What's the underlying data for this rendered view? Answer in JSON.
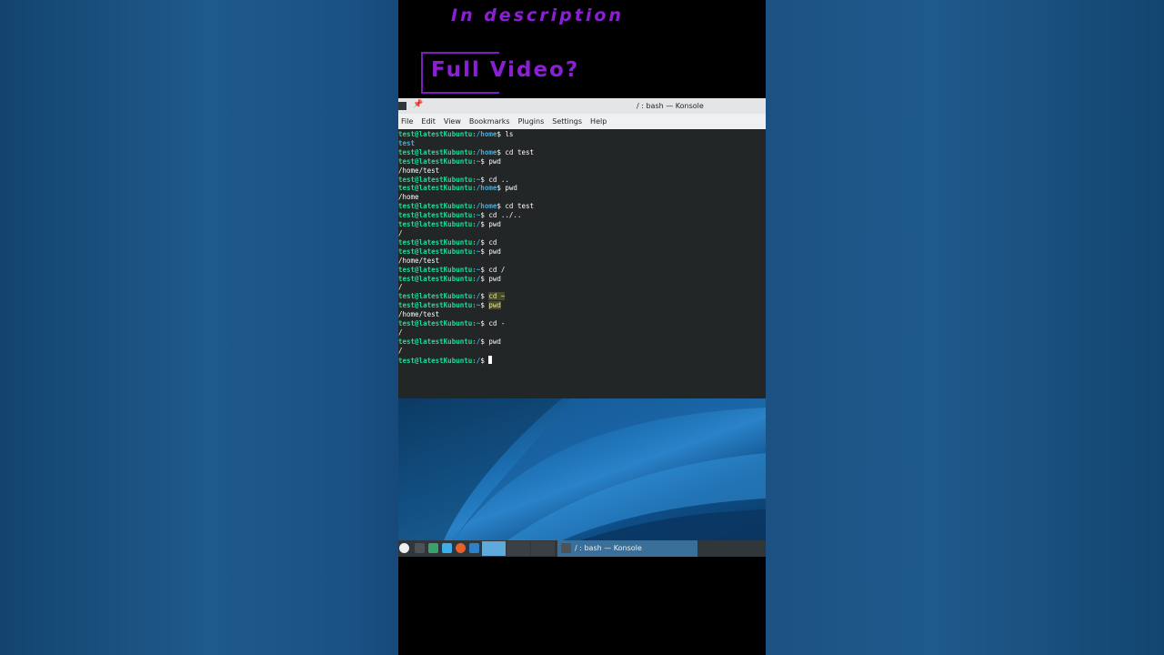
{
  "promo": {
    "top_text": "In description",
    "main_text": "Full Video?"
  },
  "window": {
    "title": "/ : bash — Konsole"
  },
  "menu": [
    "File",
    "Edit",
    "View",
    "Bookmarks",
    "Plugins",
    "Settings",
    "Help"
  ],
  "terminal": {
    "user": "test@latestKubuntu",
    "lines": [
      {
        "path": "/home",
        "cmd": "ls"
      },
      {
        "out": "test",
        "color": "path"
      },
      {
        "path": "/home",
        "cmd": "cd test"
      },
      {
        "path": "~",
        "cmd": "pwd"
      },
      {
        "out": "/home/test"
      },
      {
        "path": "~",
        "cmd": "cd .."
      },
      {
        "path": "/home",
        "cmd": "pwd"
      },
      {
        "out": "/home"
      },
      {
        "path": "/home",
        "cmd": "cd test"
      },
      {
        "path": "~",
        "cmd": "cd ../.."
      },
      {
        "path": "/",
        "cmd": "pwd"
      },
      {
        "out": "/"
      },
      {
        "path": "/",
        "cmd": "cd"
      },
      {
        "path": "~",
        "cmd": "pwd"
      },
      {
        "out": "/home/test"
      },
      {
        "path": "~",
        "cmd": "cd /"
      },
      {
        "path": "/",
        "cmd": "pwd"
      },
      {
        "out": "/"
      },
      {
        "path": "/",
        "cmd": "cd ~",
        "highlight": true
      },
      {
        "path": "~",
        "cmd": "pwd",
        "highlight": true
      },
      {
        "out": "/home/test"
      },
      {
        "path": "~",
        "cmd": "cd -"
      },
      {
        "out": "/"
      },
      {
        "path": "/",
        "cmd": "pwd"
      },
      {
        "out": "/"
      },
      {
        "path": "/",
        "cmd": "",
        "cursor": true
      }
    ]
  },
  "taskbar": {
    "task_label": "/ : bash — Konsole"
  },
  "colors": {
    "accent": "#8b1fd6",
    "prompt_user": "#1cdc9a",
    "prompt_path": "#3daee9"
  }
}
